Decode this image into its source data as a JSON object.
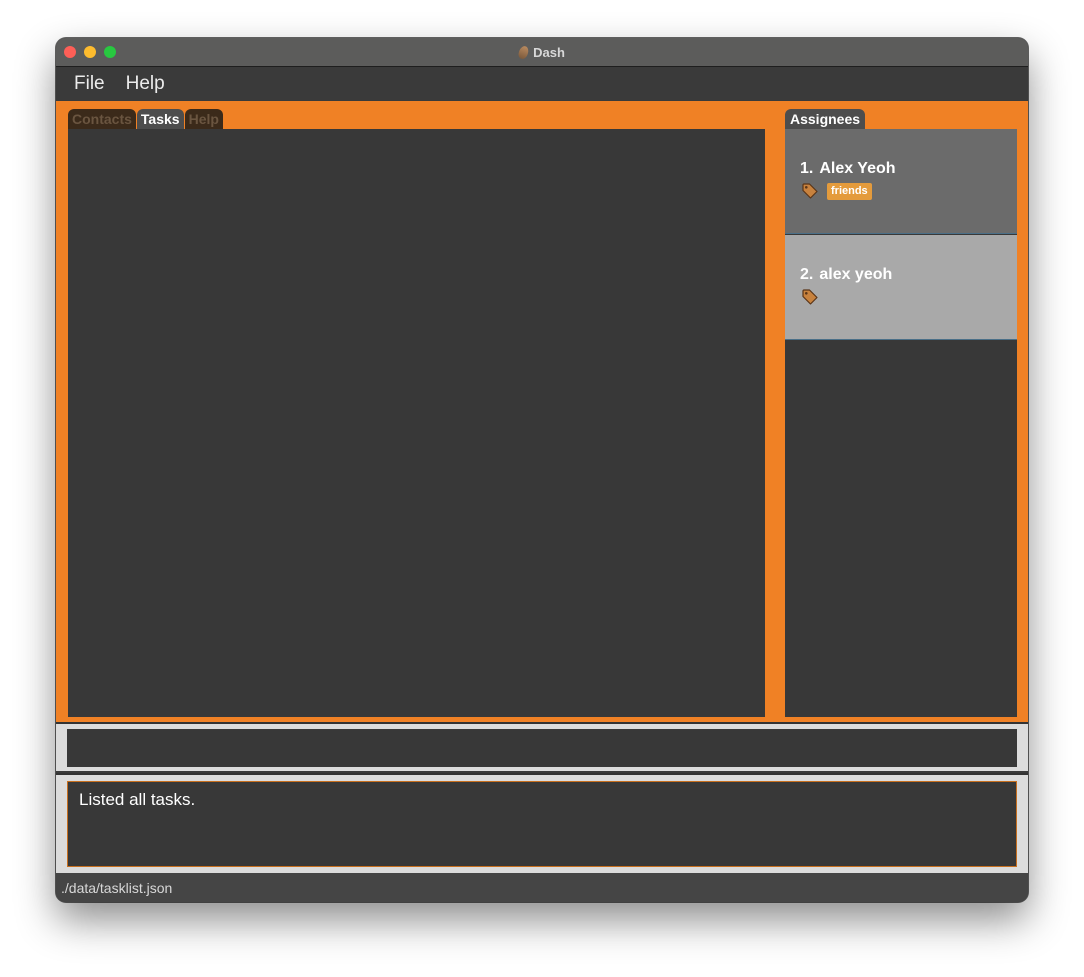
{
  "window": {
    "title": "Dash"
  },
  "menu": {
    "file": "File",
    "help": "Help"
  },
  "tabs": [
    {
      "label": "Contacts",
      "active": false
    },
    {
      "label": "Tasks",
      "active": true
    },
    {
      "label": "Help",
      "active": false
    }
  ],
  "assignees": {
    "header": "Assignees",
    "items": [
      {
        "index": "1.",
        "name": "Alex Yeoh",
        "tags": [
          "friends"
        ]
      },
      {
        "index": "2.",
        "name": "alex yeoh",
        "tags": []
      }
    ]
  },
  "command": {
    "value": ""
  },
  "result": {
    "text": "Listed all tasks."
  },
  "status": {
    "path": "./data/tasklist.json"
  },
  "colors": {
    "accent": "#f08125",
    "panel": "#383838",
    "tag": "#e49b3c"
  },
  "icons": {
    "tag": "tag-icon",
    "app": "app-icon"
  }
}
